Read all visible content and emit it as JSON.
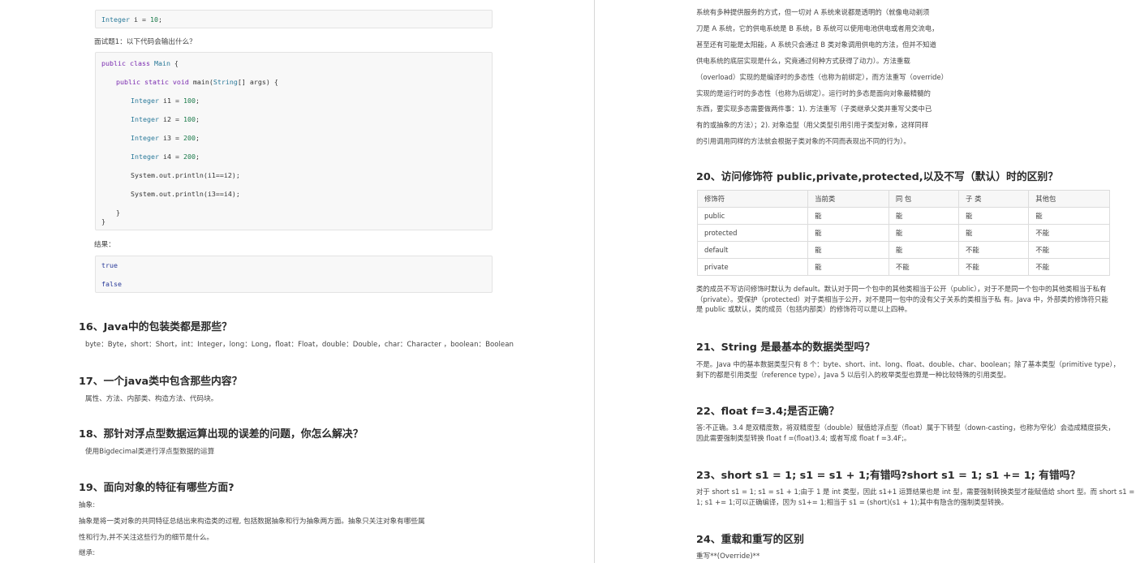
{
  "left": {
    "code_top": "Integer i = 10;",
    "q1_label": "面试题1：以下代码会输出什么？",
    "code_main": [
      "public class Main {",
      "    public static void main(String[] args) {",
      "        Integer i1 = 100;",
      "        Integer i2 = 100;",
      "        Integer i3 = 200;",
      "        Integer i4 = 200;",
      "        System.out.println(i1==i2);",
      "        System.out.println(i3==i4);",
      "    }",
      "}"
    ],
    "result_label": "结果：",
    "result_lines": [
      "true",
      "false"
    ],
    "h16": "16、Java中的包装类都是那些？",
    "p16": "byte：Byte，short：Short，int：Integer，long：Long，float：Float，double：Double，char：Character ，boolean：Boolean",
    "h17": "17、一个java类中包含那些内容？",
    "p17": "属性、方法、内部类、构造方法、代码块。",
    "h18": "18、那针对浮点型数据运算出现的误差的问题，你怎么解决？",
    "p18": "使用Bigdecimal类进行浮点型数据的运算",
    "h19": "19、面向对象的特征有哪些方面?",
    "p19_label1": "抽象:",
    "p19_line1": "抽象是将一类对象的共同特征总结出来构造类的过程, 包括数据抽象和行为抽象两方面。抽象只关注对象有哪些属",
    "p19_line2": "性和行为,并不关注这些行为的细节是什么。",
    "p19_label2": "继承:"
  },
  "right": {
    "intro_lines": [
      "系统有多种提供服务的方式，但一切对 A 系统来说都是透明的（就像电动剃须",
      "刀是 A 系统，它的供电系统是 B 系统，B 系统可以使用电池供电或者用交流电，",
      "甚至还有可能是太阳能，A 系统只会通过 B 类对象调用供电的方法，但并不知道",
      "供电系统的底层实现是什么，究竟通过何种方式获得了动力）。方法重载",
      "（overload）实现的是编译时的多态性（也称为前绑定），而方法重写（override）",
      "实现的是运行时的多态性（也称为后绑定）。运行时的多态是面向对象最精髓的",
      "东西，要实现多态需要做两件事：1). 方法重写（子类继承父类并重写父类中已",
      "有的或抽象的方法）；2). 对象造型（用父类型引用引用子类型对象，这样同样",
      "的引用调用同样的方法就会根据子类对象的不同而表现出不同的行为）。"
    ],
    "h20": "20、访问修饰符 public,private,protected,以及不写（默认）时的区别？",
    "table": {
      "headers": [
        "修饰符",
        "当前类",
        "同 包",
        "子 类",
        "其他包"
      ],
      "rows": [
        [
          "public",
          "能",
          "能",
          "能",
          "能"
        ],
        [
          "protected",
          "能",
          "能",
          "能",
          "不能"
        ],
        [
          "default",
          "能",
          "能",
          "不能",
          "不能"
        ],
        [
          "private",
          "能",
          "不能",
          "不能",
          "不能"
        ]
      ]
    },
    "p20": [
      "类的成员不写访问修饰时默认为 default。默认对于同一个包中的其他类相当于公开（public），对于不是同一个包中的其他类相当于私有",
      "（private）。受保护（protected）对子类相当于公开，对不是同一包中的没有父子关系的类相当于私 有。Java 中，外部类的修饰符只能",
      "是 public 或默认，类的成员（包括内部类）的修饰符可以是以上四种。"
    ],
    "h21": "21、String 是最基本的数据类型吗？",
    "p21": [
      "不是。Java 中的基本数据类型只有 8 个：byte、short、int、long、float、double、char、boolean；除了基本类型（primitive type），",
      "剩下的都是引用类型（reference type），Java 5 以后引入的枚举类型也算是一种比较特殊的引用类型。"
    ],
    "h22": "22、float f=3.4;是否正确？",
    "p22": [
      "答:不正确。3.4 是双精度数，将双精度型（double）赋值给浮点型（float）属于下转型（down-casting，也称为窄化）会造成精度损失，",
      "因此需要强制类型转换 float f =(float)3.4; 或者写成 float f =3.4F;。"
    ],
    "h23": "23、short s1 = 1; s1 = s1 + 1;有错吗?short s1 = 1; s1 += 1; 有错吗？",
    "p23": [
      "对于 short s1 = 1; s1 = s1 + 1;由于 1 是 int 类型，因此 s1+1 运算结果也是 int 型，需要强制转换类型才能赋值给 short 型。而 short s1 =",
      "1; s1 += 1;可以正确编译，因为 s1+= 1;相当于 s1 = (short)(s1 + 1);其中有隐含的强制类型转换。"
    ],
    "h24": "24、重载和重写的区别",
    "p24": "重写**(Override)**"
  }
}
